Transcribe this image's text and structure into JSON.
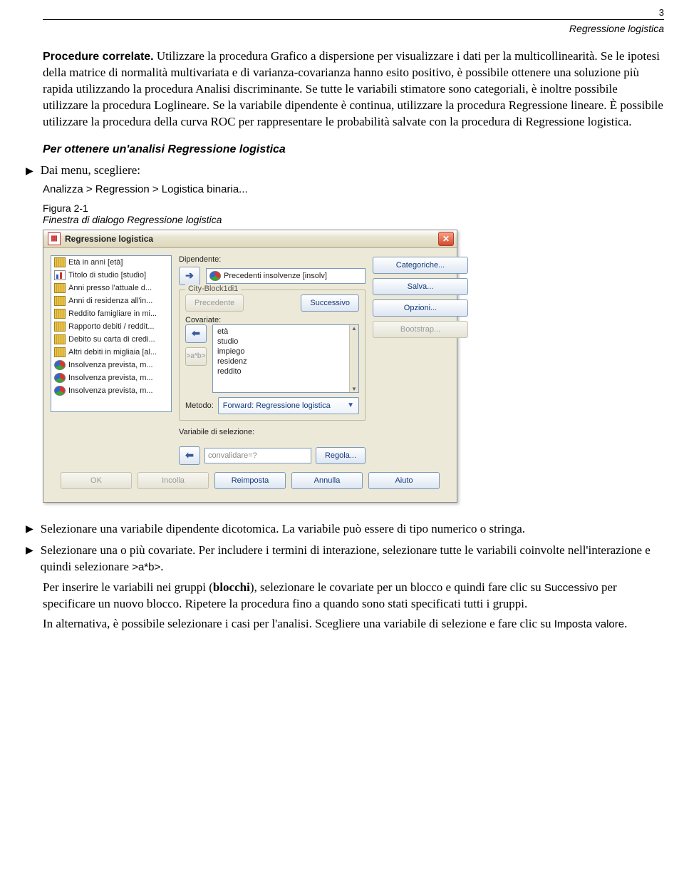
{
  "page": {
    "number": "3",
    "section": "Regressione logistica"
  },
  "intro": {
    "lead_label": "Procedure correlate.",
    "lead_rest": " Utilizzare la procedura Grafico a dispersione per visualizzare i dati per la multicollinearità. Se le ipotesi della matrice di normalità multivariata e di varianza-covarianza hanno esito positivo, è possibile ottenere una soluzione più rapida utilizzando la procedura Analisi discriminante. Se tutte le variabili stimatore sono categoriali, è inoltre possibile utilizzare la procedura Loglineare. Se la variabile dipendente è continua, utilizzare la procedura Regressione lineare. È possibile utilizzare la procedura della curva ROC per rappresentare le probabilità salvate con la procedura di Regressione logistica."
  },
  "subhead": "Per ottenere un'analisi Regressione logistica",
  "step1": {
    "text": "Dai menu, scegliere:",
    "menu": "Analizza > Regression > Logistica binaria..."
  },
  "figure": {
    "label": "Figura 2-1",
    "caption": "Finestra di dialogo Regressione logistica"
  },
  "dialog": {
    "title": "Regressione logistica",
    "labels": {
      "dependent": "Dipendente:",
      "block_legend": "City-Block1di1",
      "prev": "Precedente",
      "next": "Successivo",
      "covariate": "Covariate:",
      "method": "Metodo:",
      "selvar": "Variabile di selezione:",
      "rule": "Regola..."
    },
    "source_vars": [
      {
        "icon": "ruler",
        "label": "Età in anni [età]"
      },
      {
        "icon": "bars",
        "label": "Titolo di studio [studio]"
      },
      {
        "icon": "ruler",
        "label": "Anni presso l'attuale d..."
      },
      {
        "icon": "ruler",
        "label": "Anni di residenza all'in..."
      },
      {
        "icon": "ruler",
        "label": "Reddito famigliare in mi..."
      },
      {
        "icon": "ruler",
        "label": "Rapporto debiti / reddit..."
      },
      {
        "icon": "ruler",
        "label": "Debito su carta di credi..."
      },
      {
        "icon": "ruler",
        "label": "Altri debiti in migliaia [al..."
      },
      {
        "icon": "nom",
        "label": "Insolvenza prevista, m..."
      },
      {
        "icon": "nom",
        "label": "Insolvenza prevista, m..."
      },
      {
        "icon": "nom",
        "label": "Insolvenza prevista, m..."
      }
    ],
    "dependent_value": "Precedenti insolvenze [insolv]",
    "covariates": [
      "età",
      "studio",
      "impiego",
      "residenz",
      "reddito"
    ],
    "method_value": "Forward: Regressione logistica",
    "selvar_value": "convalidare=?",
    "interaction_btn": ">a*b>",
    "side_buttons": {
      "cat": "Categoriche...",
      "save": "Salva...",
      "opts": "Opzioni...",
      "boot": "Bootstrap..."
    },
    "footer": {
      "ok": "OK",
      "paste": "Incolla",
      "reset": "Reimposta",
      "cancel": "Annulla",
      "help": "Aiuto"
    }
  },
  "steps": {
    "s2": "Selezionare una variabile dipendente dicotomica. La variabile può essere di tipo numerico o stringa.",
    "s3a": "Selezionare una o più covariate. Per includere i termini di interazione, selezionare tutte le variabili coinvolte nell'interazione e quindi selezionare ",
    "s3_token": ">a*b>",
    "s3b": ".",
    "p2a": "Per inserire le variabili nei gruppi (",
    "p2bold": "blocchi",
    "p2b": "), selezionare le covariate per un blocco e quindi fare clic su ",
    "p2token": "Successivo",
    "p2c": " per specificare un nuovo blocco. Ripetere la procedura fino a quando sono stati specificati tutti i gruppi.",
    "p3a": "In alternativa, è possibile selezionare i casi per l'analisi. Scegliere una variabile di selezione e fare clic su ",
    "p3token": "Imposta valore",
    "p3b": "."
  }
}
